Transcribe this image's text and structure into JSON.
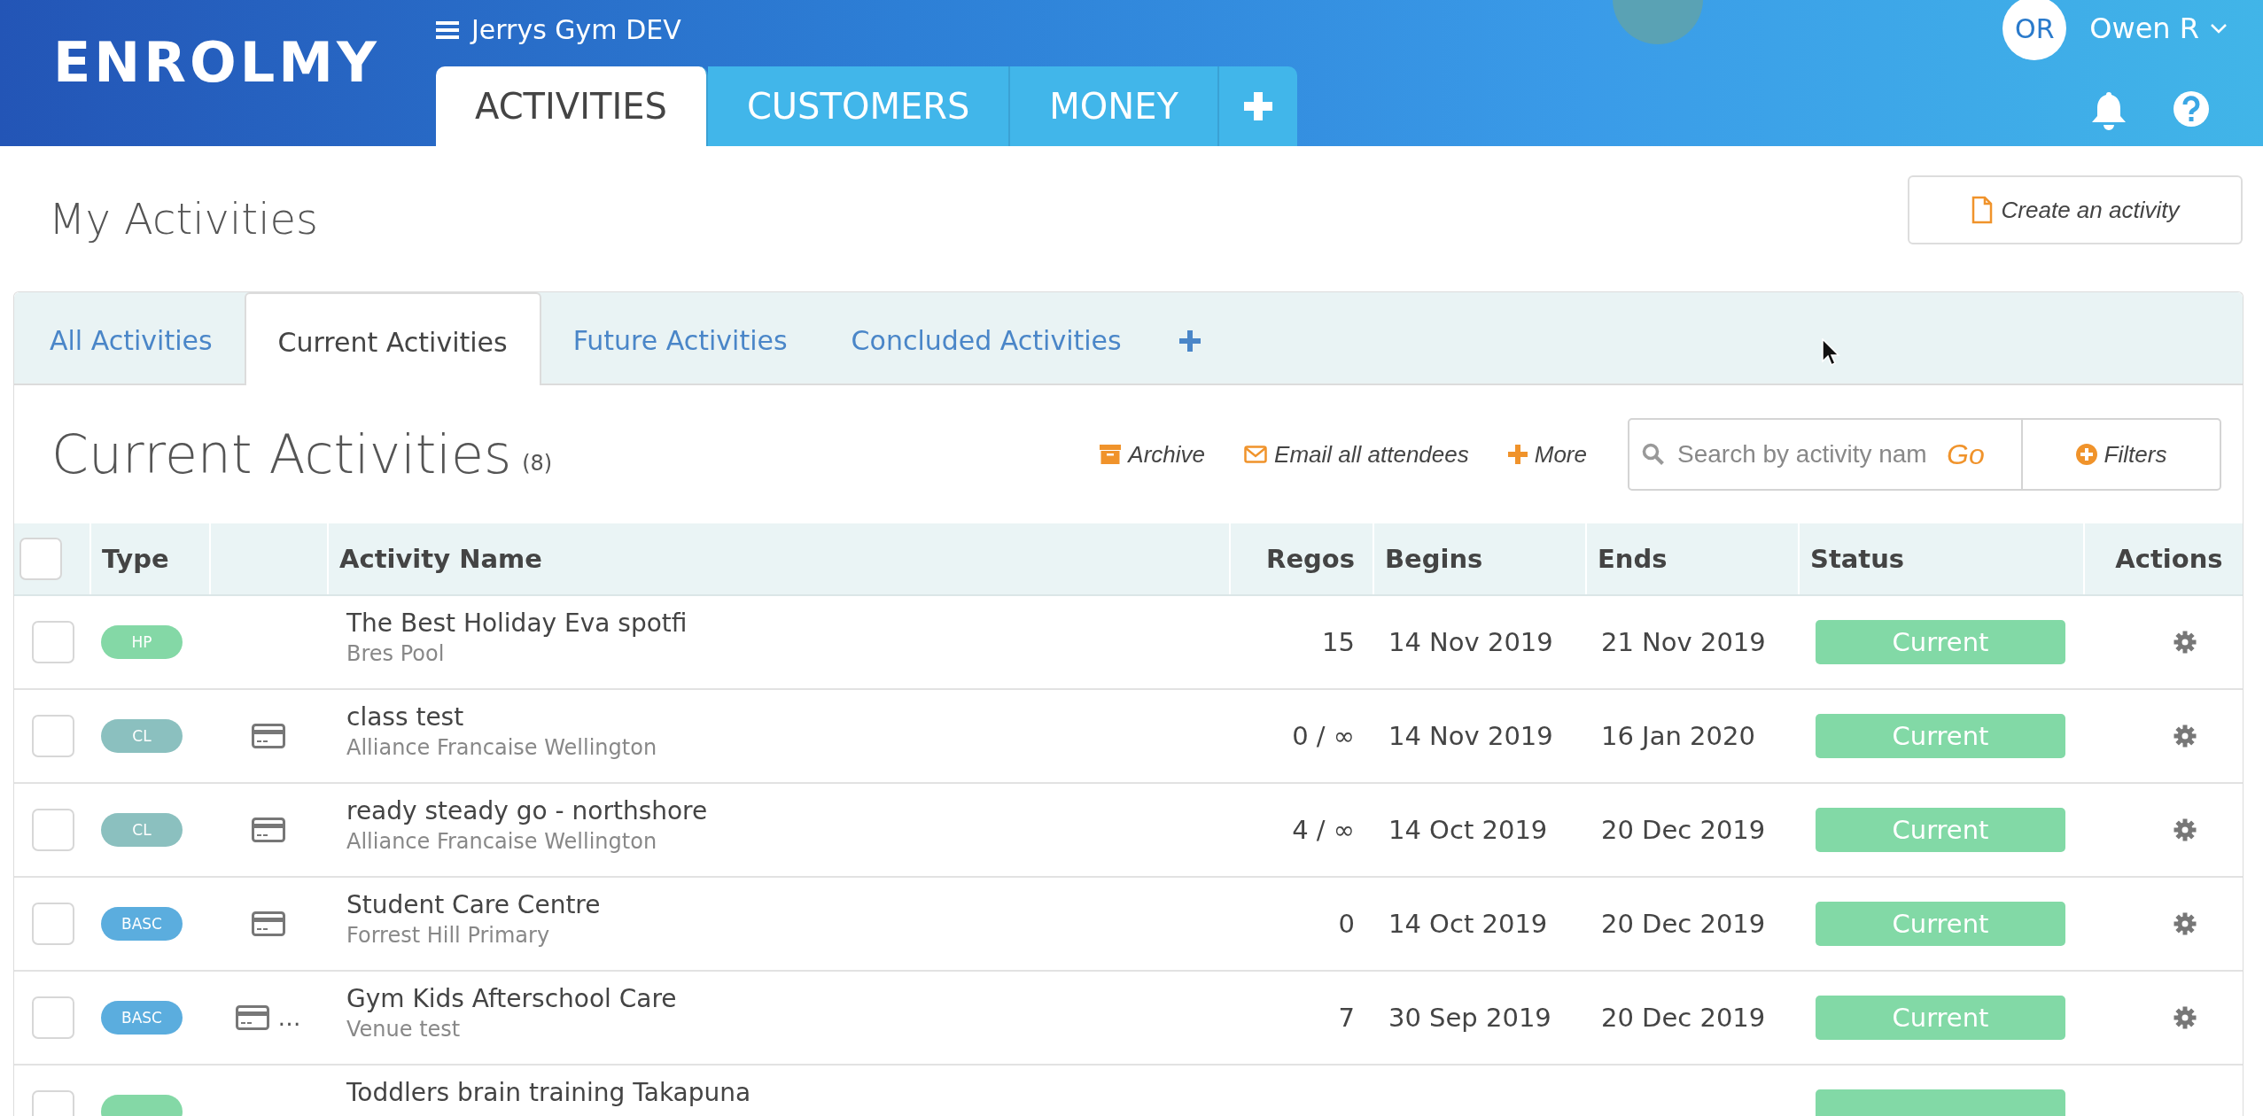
{
  "header": {
    "logo": "ENROLMY",
    "org": "Jerrys Gym DEV",
    "nav_tabs": [
      {
        "label": "ACTIVITIES",
        "selected": true
      },
      {
        "label": "CUSTOMERS",
        "selected": false
      },
      {
        "label": "MONEY",
        "selected": false
      }
    ],
    "user": {
      "initials": "OR",
      "name": "Owen R"
    }
  },
  "page": {
    "title": "My Activities",
    "create_button": "Create an activity"
  },
  "panel": {
    "tabs": [
      {
        "label": "All Activities",
        "selected": false
      },
      {
        "label": "Current Activities",
        "selected": true
      },
      {
        "label": "Future Activities",
        "selected": false
      },
      {
        "label": "Concluded Activities",
        "selected": false
      }
    ],
    "heading": "Current Activities",
    "count": "(8)",
    "actions": [
      {
        "label": "Archive",
        "kind": "archive"
      },
      {
        "label": "Email all attendees",
        "kind": "email"
      },
      {
        "label": "More",
        "kind": "more"
      }
    ],
    "search": {
      "placeholder": "Search by activity nam",
      "go": "Go"
    },
    "filters": "Filters"
  },
  "table": {
    "all_selected": false,
    "columns": [
      "Type",
      "Activity Name",
      "Regos",
      "Begins",
      "Ends",
      "Status",
      "Actions"
    ],
    "rows": [
      {
        "selected": false,
        "type": "HP",
        "color": "#84d8a6",
        "card": false,
        "name": "The Best Holiday Eva spotfi",
        "venue": "Bres Pool",
        "regos": "15",
        "begins": "14 Nov 2019",
        "ends": "21 Nov 2019",
        "status": "Current"
      },
      {
        "selected": false,
        "type": "CL",
        "color": "#8bc0bf",
        "card": true,
        "name": "class test",
        "venue": "Alliance Francaise Wellington",
        "regos": "0 / ∞",
        "begins": "14 Nov 2019",
        "ends": "16 Jan 2020",
        "status": "Current"
      },
      {
        "selected": false,
        "type": "CL",
        "color": "#8bc0bf",
        "card": true,
        "name": "ready steady go - northshore",
        "venue": "Alliance Francaise Wellington",
        "regos": "4 / ∞",
        "begins": "14 Oct 2019",
        "ends": "20 Dec 2019",
        "status": "Current"
      },
      {
        "selected": false,
        "type": "BASC",
        "color": "#5badde",
        "card": true,
        "name": "Student Care Centre",
        "venue": "Forrest Hill Primary",
        "regos": "0",
        "begins": "14 Oct 2019",
        "ends": "20 Dec 2019",
        "status": "Current"
      },
      {
        "selected": false,
        "type": "BASC",
        "color": "#5badde",
        "card": true,
        "extra": "…",
        "name": "Gym Kids Afterschool Care",
        "venue": "Venue test",
        "regos": "7",
        "begins": "30 Sep 2019",
        "ends": "20 Dec 2019",
        "status": "Current"
      },
      {
        "selected": false,
        "color": "#84d8a6",
        "card": false,
        "name": "Toddlers brain training Takapuna"
      }
    ]
  }
}
